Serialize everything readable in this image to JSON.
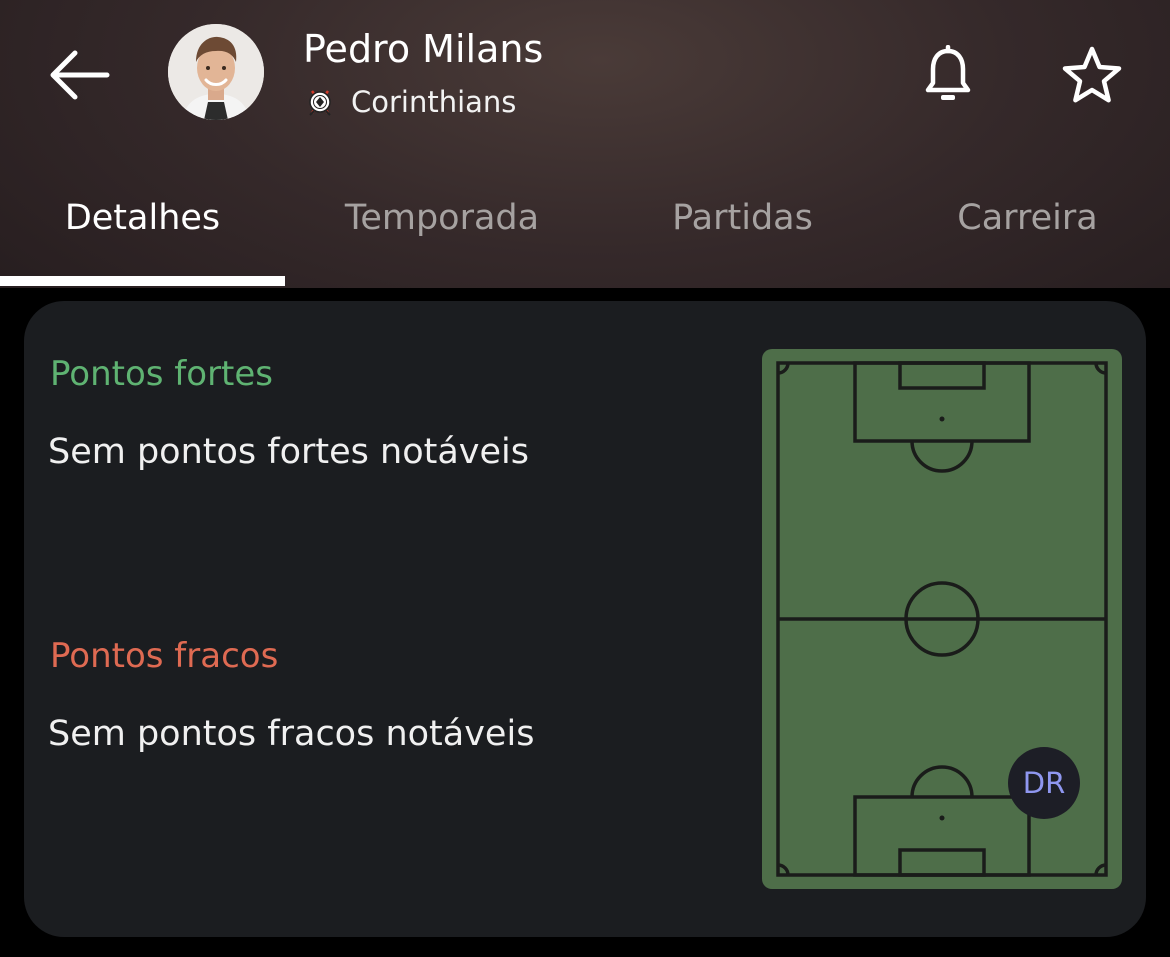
{
  "header": {
    "player_name": "Pedro Milans",
    "team_name": "Corinthians",
    "icons": {
      "back": "arrow-left-icon",
      "avatar": "player-photo",
      "team_logo": "corinthians-crest-icon",
      "notifications": "bell-icon",
      "favorite": "star-outline-icon"
    }
  },
  "tabs": [
    {
      "label": "Detalhes",
      "active": true
    },
    {
      "label": "Temporada",
      "active": false
    },
    {
      "label": "Partidas",
      "active": false
    },
    {
      "label": "Carreira",
      "active": false
    }
  ],
  "card": {
    "strengths": {
      "title": "Pontos fortes",
      "text": "Sem pontos fortes notáveis"
    },
    "weaknesses": {
      "title": "Pontos fracos",
      "text": "Sem pontos fracos notáveis"
    },
    "position": {
      "label": "DR"
    }
  },
  "colors": {
    "strengths_title": "#5fb372",
    "weaknesses_title": "#df6a52",
    "pitch_green": "#4e6e49",
    "pitch_lines": "#1a1c1a",
    "position_text": "#8f97f0",
    "card_background": "#1b1d20"
  }
}
